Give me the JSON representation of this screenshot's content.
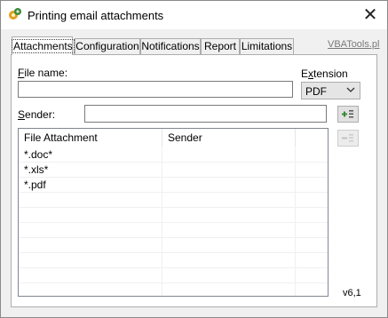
{
  "window": {
    "title": "Printing email attachments",
    "close_glyph": "✕"
  },
  "tabs": [
    {
      "label": "Attachments",
      "active": true
    },
    {
      "label": "Configuration",
      "active": false
    },
    {
      "label": "Notifications",
      "active": false
    },
    {
      "label": "Report",
      "active": false
    },
    {
      "label": "Limitations",
      "active": false
    }
  ],
  "brand_link": "VBATools.pl",
  "form": {
    "file_name": {
      "label_accel": "F",
      "label_rest": "ile name:",
      "value": ""
    },
    "extension": {
      "label_prefix": "E",
      "label_accel": "x",
      "label_rest": "tension",
      "value": "PDF"
    },
    "sender": {
      "label_accel": "S",
      "label_rest": "ender:",
      "value": ""
    }
  },
  "buttons": {
    "add_icon": "add-row-icon",
    "remove_icon": "remove-row-icon"
  },
  "list": {
    "columns": [
      "File Attachment",
      "Sender"
    ],
    "rows": [
      {
        "file": "*.doc*",
        "sender": ""
      },
      {
        "file": "*.xls*",
        "sender": ""
      },
      {
        "file": "*.pdf",
        "sender": ""
      }
    ]
  },
  "version": "v6,1",
  "colors": {
    "accent_green": "#3a8a3a",
    "window_bg": "#f0f0f0"
  }
}
